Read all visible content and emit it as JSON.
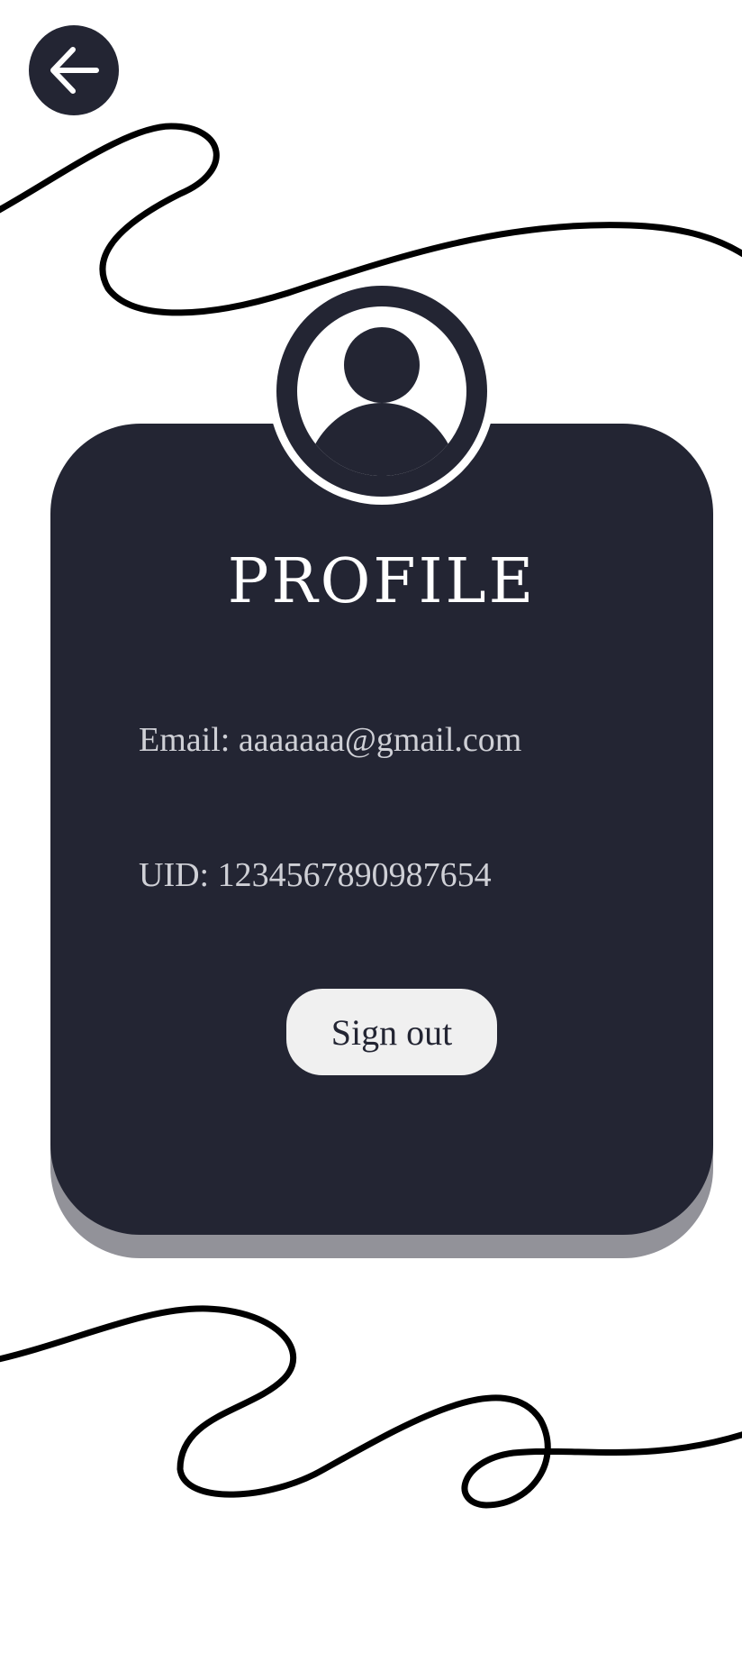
{
  "header": {
    "back_icon": "arrow-left-icon"
  },
  "profile": {
    "avatar_icon": "user-avatar-icon",
    "title": "PROFILE",
    "email_label": "Email:",
    "email_value": "aaaaaaa@gmail.com",
    "uid_label": "UID:",
    "uid_value": "1234567890987654",
    "signout_label": "Sign out"
  },
  "colors": {
    "card": "#232533",
    "card_shadow": "#929299",
    "button_bg": "#f0f0f0",
    "text_light": "#ffffff",
    "text_muted": "#cfd0d6",
    "squiggle": "#000000"
  }
}
